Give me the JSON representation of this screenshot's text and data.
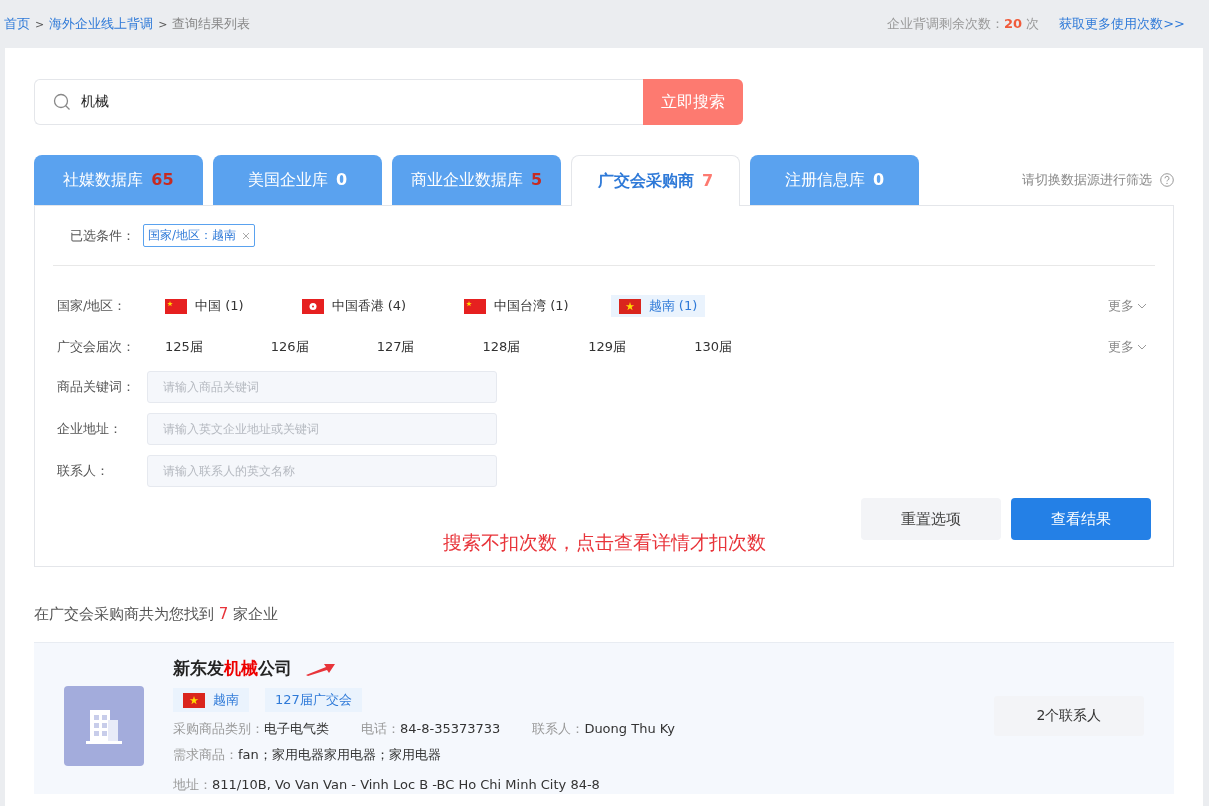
{
  "breadcrumb": [
    {
      "label": "首页",
      "link": true
    },
    {
      "separator": ">",
      "label": "海外企业线上背调",
      "link": true
    },
    {
      "separator": ">",
      "label": "查询结果列表",
      "link": false
    }
  ],
  "quota": {
    "text": "企业背调剩余次数：**20** 次",
    "more_link": "获取更多使用次数>>"
  },
  "search": {
    "value": "机械",
    "button": "立即搜索"
  },
  "tabs": [
    {
      "label": "社媒数据库",
      "count": "65",
      "emphasized": true,
      "selected": false
    },
    {
      "label": "美国企业库",
      "count": "0",
      "emphasized": false,
      "selected": false
    },
    {
      "label": "商业企业数据库",
      "count": "5",
      "emphasized": true,
      "selected": false
    },
    {
      "label": "广交会采购商",
      "count": "7",
      "emphasized": true,
      "selected": true
    },
    {
      "label": "注册信息库",
      "count": "0",
      "emphasized": false,
      "selected": false
    }
  ],
  "tabs_hint": "请切换数据源进行筛选",
  "filters": {
    "selected_label": "已选条件：",
    "selected_tags": [
      "国家/地区：越南"
    ],
    "country": {
      "label": "国家/地区：",
      "more": "更多",
      "options": [
        {
          "kind": "cn",
          "label": "中国",
          "count": "(1)",
          "selected": false
        },
        {
          "kind": "hk",
          "label": "中国香港",
          "count": "(4)",
          "selected": false
        },
        {
          "kind": "cn",
          "label": "中国台湾",
          "count": "(1)",
          "selected": false
        },
        {
          "kind": "vn",
          "label": "越南",
          "count": "(1)",
          "selected": true
        }
      ]
    },
    "session": {
      "label": "广交会届次：",
      "more": "更多",
      "options": [
        {
          "label": "125届",
          "selected": false
        },
        {
          "label": "126届",
          "selected": false
        },
        {
          "label": "127届",
          "selected": false
        },
        {
          "label": "128届",
          "selected": false
        },
        {
          "label": "129届",
          "selected": false
        },
        {
          "label": "130届",
          "selected": false
        }
      ]
    },
    "inputs": [
      {
        "label": "商品关键词：",
        "placeholder": "请输入商品关键词"
      },
      {
        "label": "企业地址：",
        "placeholder": "请输入英文企业地址或关键词"
      },
      {
        "label": "联系人：",
        "placeholder": "请输入联系人的英文名称"
      }
    ],
    "reset_button": "重置选项",
    "submit_button": "查看结果",
    "note": "搜索不扣次数，点击查看详情才扣次数"
  },
  "result_summary": "在广交会采购商共为您找到 **7** 家企业",
  "results": [
    {
      "name": "新东发**机械**公司",
      "country": {
        "kind": "vn",
        "label": "越南"
      },
      "session_tag": "127届广交会",
      "fields": [
        {
          "label": "采购商品类别：",
          "value": "电子电气类"
        },
        {
          "label": "电话：",
          "value": "84-8-35373733"
        },
        {
          "label": "联系人：",
          "value": "Duong Thu Ky"
        }
      ],
      "demand": {
        "label": "需求商品：",
        "value": "fan；家用电器家用电器；家用电器"
      },
      "address": {
        "label": "地址：",
        "value": "811/10B, Vo Van Van - Vinh Loc B -BC Ho Chi Minh City 84-8"
      },
      "contacts_button": "2个联系人"
    }
  ]
}
